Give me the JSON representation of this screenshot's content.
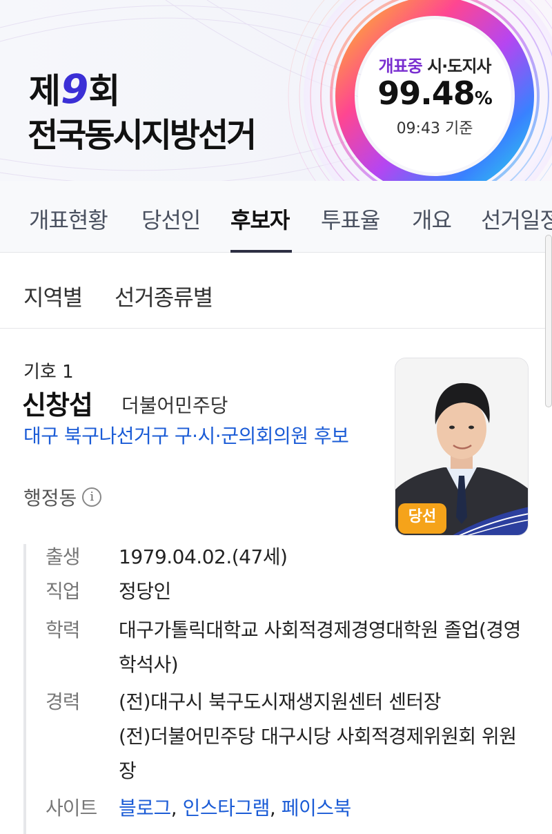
{
  "banner": {
    "title_prefix": "제",
    "title_number": "9",
    "title_suffix": "회",
    "title_line2": "전국동시지방선거",
    "status_live": "개표중",
    "status_kind": "시·도지사",
    "status_percent": "99.48",
    "status_percent_unit": "%",
    "status_time": "09:43 기준"
  },
  "main_tabs": [
    "개표현황",
    "당선인",
    "후보자",
    "투표율",
    "개요",
    "선거일정"
  ],
  "active_main_tab": "후보자",
  "sub_tabs": [
    "지역별",
    "선거종류별"
  ],
  "candidate": {
    "number": "기호 1",
    "name": "신창섭",
    "party": "더불어민주당",
    "district": "대구 북구나선거구 구·시·군의회의원 후보",
    "dong": "행정동",
    "info_icon": "info-icon",
    "badge": "당선"
  },
  "details": {
    "birth_label": "출생",
    "birth_value": "1979.04.02.(47세)",
    "job_label": "직업",
    "job_value": "정당인",
    "edu_label": "학력",
    "edu_value": "대구가톨릭대학교 사회적경제경영대학원 졸업(경영학석사)",
    "career_label": "경력",
    "career_line1": "(전)대구시 북구도시재생지원센터 센터장",
    "career_line2": "(전)더불어민주당 대구시당 사회적경제위원회 위원장",
    "site_label": "사이트",
    "site_links": [
      "블로그",
      "인스타그램",
      "페이스북"
    ]
  },
  "colors": {
    "accent_blue": "#1a5bd6",
    "title_nine": "#3b2fd6",
    "live_purple": "#7a2fd0",
    "badge_orange": "#f5a31a"
  }
}
